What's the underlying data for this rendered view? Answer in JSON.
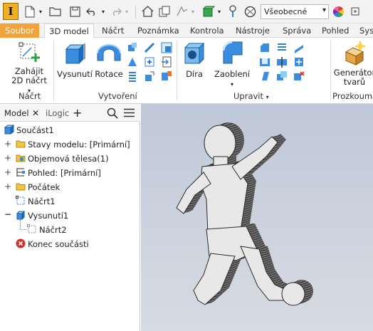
{
  "app": {
    "logo_letter": "I"
  },
  "quick_access": {
    "style_select": {
      "value": "Všeobecné",
      "arrow": "▾"
    }
  },
  "tabs": [
    {
      "label": "Soubor"
    },
    {
      "label": "3D model"
    },
    {
      "label": "Náčrt"
    },
    {
      "label": "Poznámka"
    },
    {
      "label": "Kontrola"
    },
    {
      "label": "Nástroje"
    },
    {
      "label": "Správa"
    },
    {
      "label": "Pohled"
    },
    {
      "label": "Sys"
    }
  ],
  "ribbon": {
    "sketch_group": {
      "button_line1": "Zahájit",
      "button_line2": "2D náčrt",
      "button_arrow": "▾",
      "label": "Náčrt"
    },
    "create_group": {
      "extrude": "Vysunutí",
      "revolve": "Rotace",
      "label": "Vytvoření"
    },
    "modify_group": {
      "hole": "Díra",
      "fillet": "Zaoblení",
      "fillet_arrow": "▾",
      "label": "Upravit",
      "label_arrow": "▾"
    },
    "explore_group": {
      "button_line1": "Generátor",
      "button_line2": "tvarů",
      "label": "Prozkouma"
    }
  },
  "browser": {
    "tabs": [
      {
        "label": "Model"
      },
      {
        "label": "iLogic"
      }
    ],
    "close_glyph": "✕",
    "add_glyph": "+",
    "items": [
      {
        "label": "Součást1",
        "icon": "part-icon"
      },
      {
        "label": "Stavy modelu: [Primární]",
        "icon": "folder-icon",
        "expander": "+"
      },
      {
        "label": "Objemová tělesa(1)",
        "icon": "folder-icon",
        "expander": "+"
      },
      {
        "label": "Pohled: [Primární]",
        "icon": "view-icon",
        "expander": "+"
      },
      {
        "label": "Počátek",
        "icon": "folder-icon",
        "expander": "+"
      },
      {
        "label": "Náčrt1",
        "icon": "sketch-icon"
      },
      {
        "label": "Vysunutí1",
        "icon": "extrude-icon",
        "expander": "−"
      },
      {
        "label": "Náčrt2",
        "icon": "sketch-icon"
      },
      {
        "label": "Konec součásti",
        "icon": "end-of-part-icon"
      }
    ]
  },
  "colors": {
    "accent_orange": "#f2a33a",
    "ribbon_blue": "#2f7fd2",
    "viewport_top": "#bfc8d8"
  }
}
